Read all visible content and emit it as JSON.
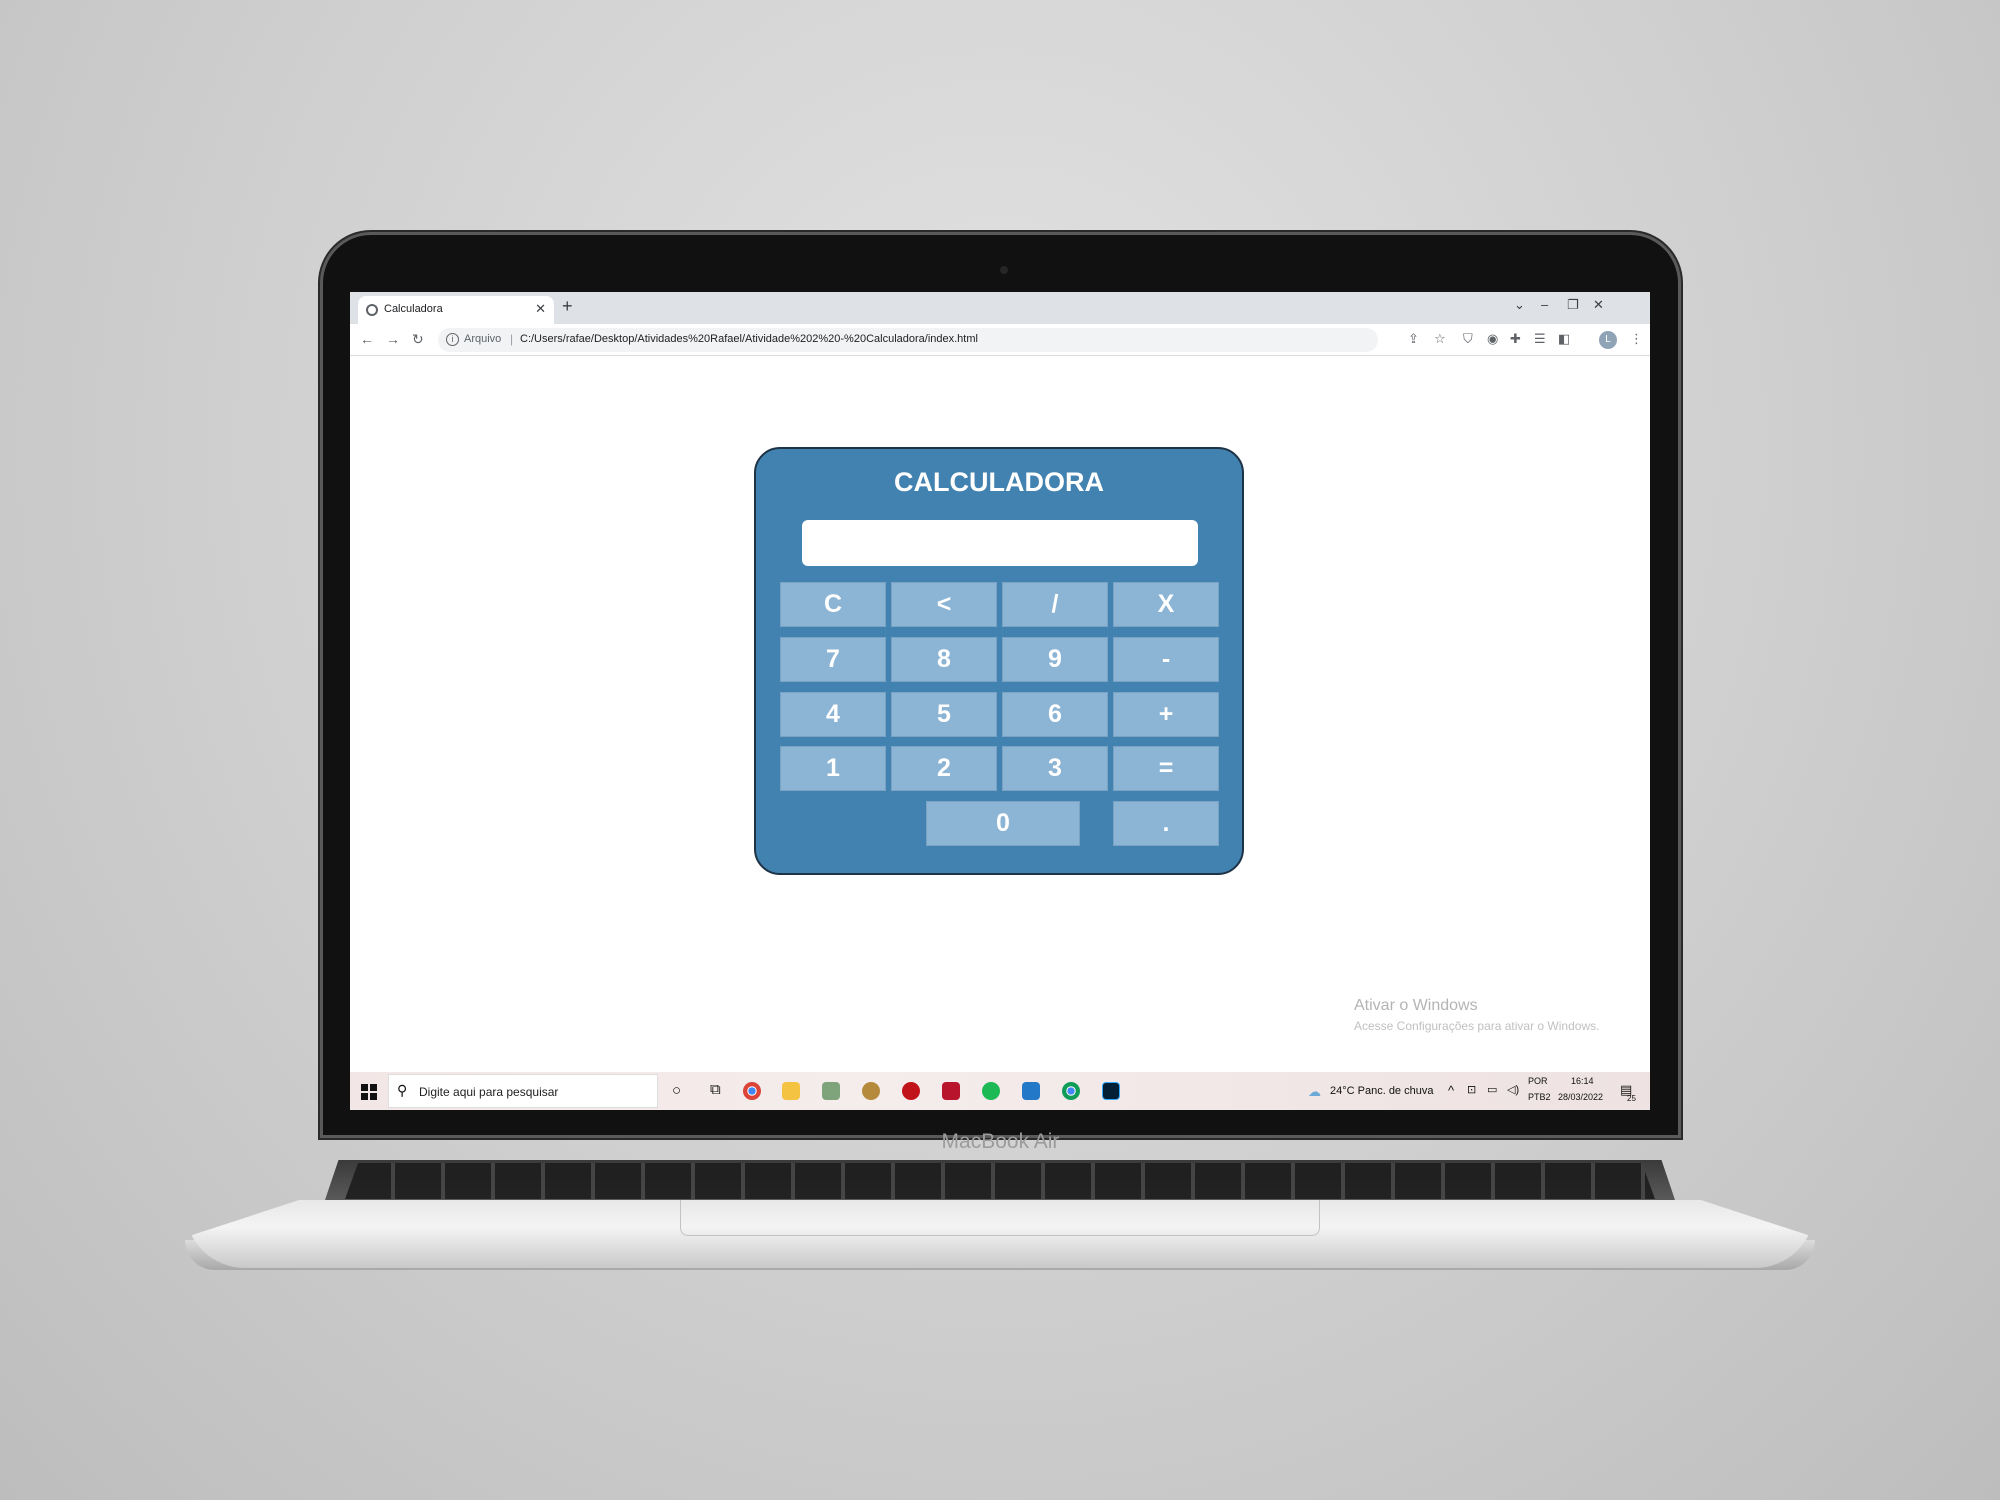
{
  "browser": {
    "tab_title": "Calculadora",
    "new_tab": "+",
    "omnibox_label": "Arquivo",
    "url": "C:/Users/rafae/Desktop/Atividades%20Rafael/Atividade%202%20-%20Calculadora/index.html"
  },
  "calculator": {
    "title": "CALCULADORA",
    "display_value": "",
    "buttons": {
      "clear": "C",
      "back": "<",
      "divide": "/",
      "multiply": "X",
      "seven": "7",
      "eight": "8",
      "nine": "9",
      "minus": "-",
      "four": "4",
      "five": "5",
      "six": "6",
      "plus": "+",
      "one": "1",
      "two": "2",
      "three": "3",
      "equals": "=",
      "zero": "0",
      "dot": "."
    }
  },
  "watermark": {
    "title": "Ativar o Windows",
    "subtitle": "Acesse Configurações para ativar o Windows."
  },
  "taskbar": {
    "search_placeholder": "Digite aqui para pesquisar",
    "weather": "24°C  Panc. de chuva",
    "lang_top": "POR",
    "lang_bottom": "PTB2",
    "time": "16:14",
    "date": "28/03/2022",
    "notifications": "25"
  },
  "laptop": {
    "brand": "MacBook Air"
  },
  "colors": {
    "calculator_bg": "#4282b0",
    "button_bg": "#8cb4d4",
    "button_text": "#ffffff"
  }
}
